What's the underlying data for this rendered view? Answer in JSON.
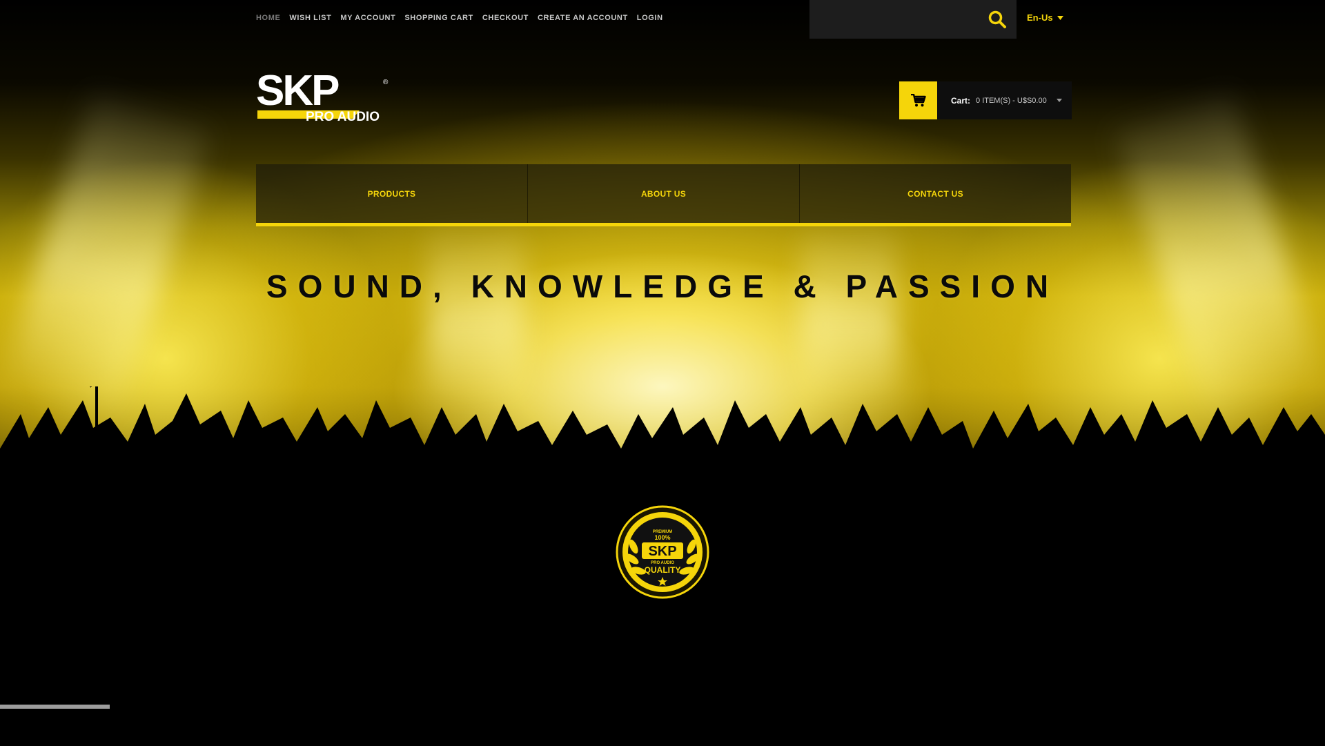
{
  "topnav": {
    "items": [
      "HOME",
      "WISH LIST",
      "MY ACCOUNT",
      "SHOPPING CART",
      "CHECKOUT",
      "CREATE AN ACCOUNT",
      "LOGIN"
    ]
  },
  "search": {
    "value": "",
    "placeholder": "",
    "icon": "search-icon"
  },
  "language": {
    "selected": "En-Us"
  },
  "logo": {
    "wordmark": "SKP",
    "tagline": "PRO AUDIO",
    "registered": "®"
  },
  "cart": {
    "label": "Cart:",
    "value": "0 ITEM(S) - U$S0.00",
    "icon": "cart-icon"
  },
  "mainnav": {
    "items": [
      "PRODUCTS",
      "ABOUT US",
      "CONTACT US"
    ]
  },
  "hero": {
    "headline": "SOUND, KNOWLEDGE & PASSION"
  },
  "badge": {
    "top_text": "PREMIUM",
    "percent": "100%",
    "wordmark": "SKP",
    "sub": "PRO AUDIO",
    "bottom_text": "QUALITY"
  },
  "slider": {
    "progress": 0.083
  },
  "colors": {
    "accent": "#f5d50a",
    "background": "#000000",
    "nav_text": "#c9c9c9"
  }
}
